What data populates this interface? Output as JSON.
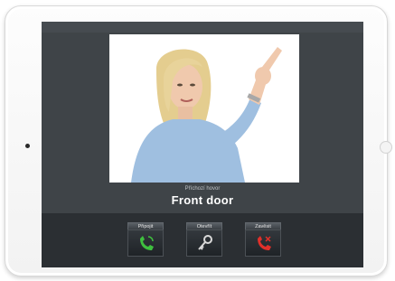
{
  "call": {
    "subtitle": "Příchozí hovor",
    "location": "Front door"
  },
  "controls": {
    "answer_label": "Připojit",
    "unlock_label": "Otevřít",
    "hangup_label": "Zavěsit"
  },
  "colors": {
    "screen": "#3f4448",
    "control_bar": "#2b2f33",
    "answer": "#3fbf3f",
    "hangup": "#e0302a",
    "key": "#d9d9d9"
  },
  "icons": {
    "answer": "phone-answer-icon",
    "unlock": "key-icon",
    "hangup": "phone-hangup-icon"
  }
}
